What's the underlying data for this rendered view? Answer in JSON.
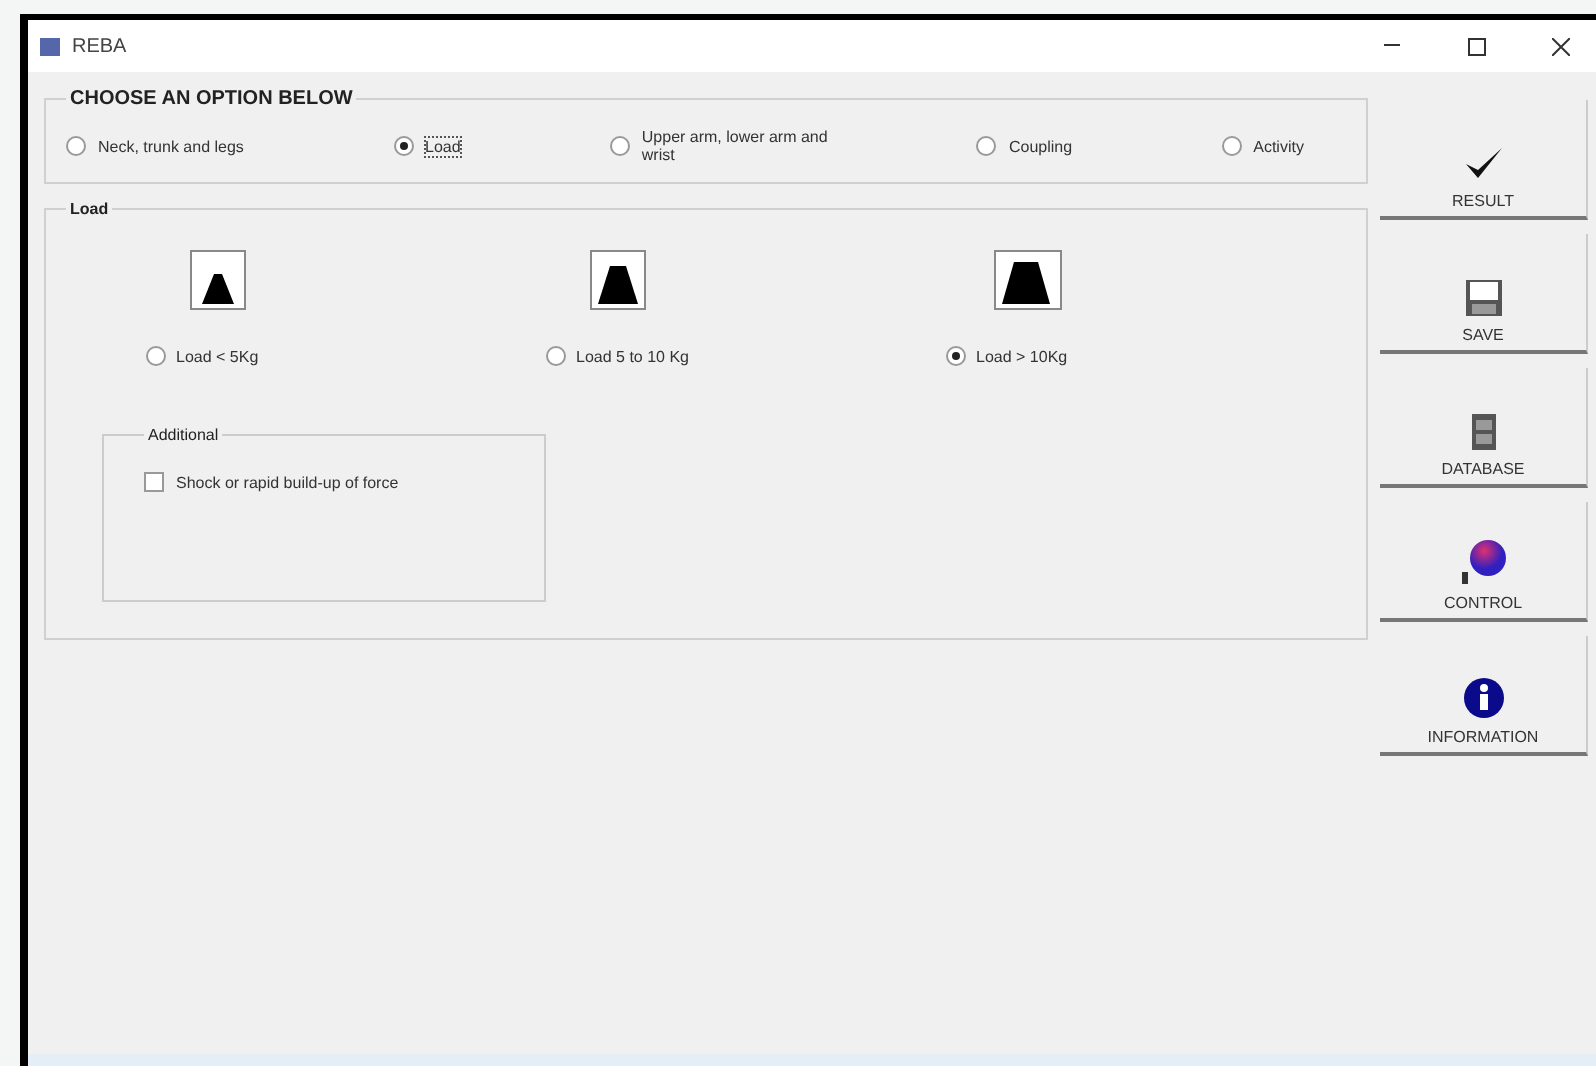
{
  "window": {
    "title": "REBA"
  },
  "options": {
    "title": "CHOOSE AN OPTION BELOW",
    "items": [
      {
        "label": "Neck, trunk and legs",
        "selected": false
      },
      {
        "label": "Load",
        "selected": true
      },
      {
        "label": "Upper arm, lower arm and wrist",
        "selected": false
      },
      {
        "label": "Coupling",
        "selected": false
      },
      {
        "label": "Activity",
        "selected": false
      }
    ]
  },
  "load": {
    "title": "Load",
    "items": [
      {
        "label": "Load < 5Kg",
        "kind": "small",
        "selected": false
      },
      {
        "label": "Load 5 to 10 Kg",
        "kind": "medium",
        "selected": false
      },
      {
        "label": "Load > 10Kg",
        "kind": "large",
        "selected": true
      }
    ],
    "additional": {
      "title": "Additional",
      "checkbox": {
        "label": "Shock or rapid build-up of force",
        "checked": false
      }
    }
  },
  "side_buttons": [
    {
      "kind": "result",
      "label": "RESULT"
    },
    {
      "kind": "save",
      "label": "SAVE"
    },
    {
      "kind": "database",
      "label": "DATABASE"
    },
    {
      "kind": "control",
      "label": "CONTROL"
    },
    {
      "kind": "information",
      "label": "INFORMATION"
    }
  ]
}
